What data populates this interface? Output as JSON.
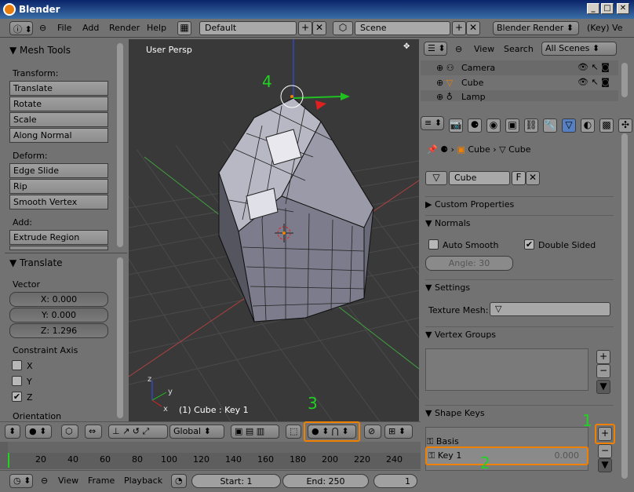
{
  "window": {
    "title": "Blender"
  },
  "info_header": {
    "menus": [
      "File",
      "Add",
      "Render",
      "Help"
    ],
    "layout_name": "Default",
    "scene_name": "Scene",
    "render_engine": "Blender Render",
    "status_text": "(Key) Ve"
  },
  "tool_panel": {
    "title": "Mesh Tools",
    "transform_label": "Transform:",
    "transform_buttons": [
      "Translate",
      "Rotate",
      "Scale",
      "Along Normal"
    ],
    "deform_label": "Deform:",
    "deform_buttons": [
      "Edge Slide",
      "Rip",
      "Smooth Vertex"
    ],
    "add_label": "Add:",
    "add_buttons": [
      "Extrude Region"
    ],
    "op_title": "Translate",
    "vector_label": "Vector",
    "vector_fields": [
      "X: 0.000",
      "Y: 0.000",
      "Z: 1.296"
    ],
    "constraint_label": "Constraint Axis",
    "constraints": [
      {
        "label": "X",
        "checked": false
      },
      {
        "label": "Y",
        "checked": false
      },
      {
        "label": "Z",
        "checked": true
      }
    ],
    "orientation_label": "Orientation"
  },
  "viewport": {
    "view_label": "User Persp",
    "object_label": "(1) Cube : Key 1"
  },
  "view3d_header": {
    "orientation": "Global"
  },
  "outliner": {
    "menus": [
      "View",
      "Search"
    ],
    "scene_filter": "All Scenes",
    "items": [
      "Camera",
      "Cube",
      "Lamp"
    ]
  },
  "properties": {
    "breadcrumb": [
      "Cube",
      "Cube"
    ],
    "mesh_name": "Cube",
    "fake_user_label": "F",
    "panels": {
      "custom_props": "Custom Properties",
      "normals": "Normals",
      "auto_smooth": "Auto Smooth",
      "double_sided": "Double Sided",
      "angle": "Angle: 30",
      "settings": "Settings",
      "texture_mesh": "Texture Mesh:",
      "vertex_groups": "Vertex Groups",
      "shape_keys": "Shape Keys"
    },
    "shape_keys": [
      {
        "name": "Basis",
        "value": ""
      },
      {
        "name": "Key 1",
        "value": "0.000"
      }
    ]
  },
  "timeline": {
    "ticks": [
      "20",
      "40",
      "60",
      "80",
      "100",
      "120",
      "140",
      "160",
      "180",
      "200",
      "220",
      "240"
    ],
    "menus": [
      "View",
      "Frame",
      "Playback"
    ],
    "start": "Start: 1",
    "end": "End: 250",
    "current": "1"
  },
  "annotations": [
    "1",
    "2",
    "3",
    "4"
  ],
  "colors": {
    "highlight": "#f08000",
    "annotation": "#21d321",
    "active_tab": "#5680c2"
  }
}
